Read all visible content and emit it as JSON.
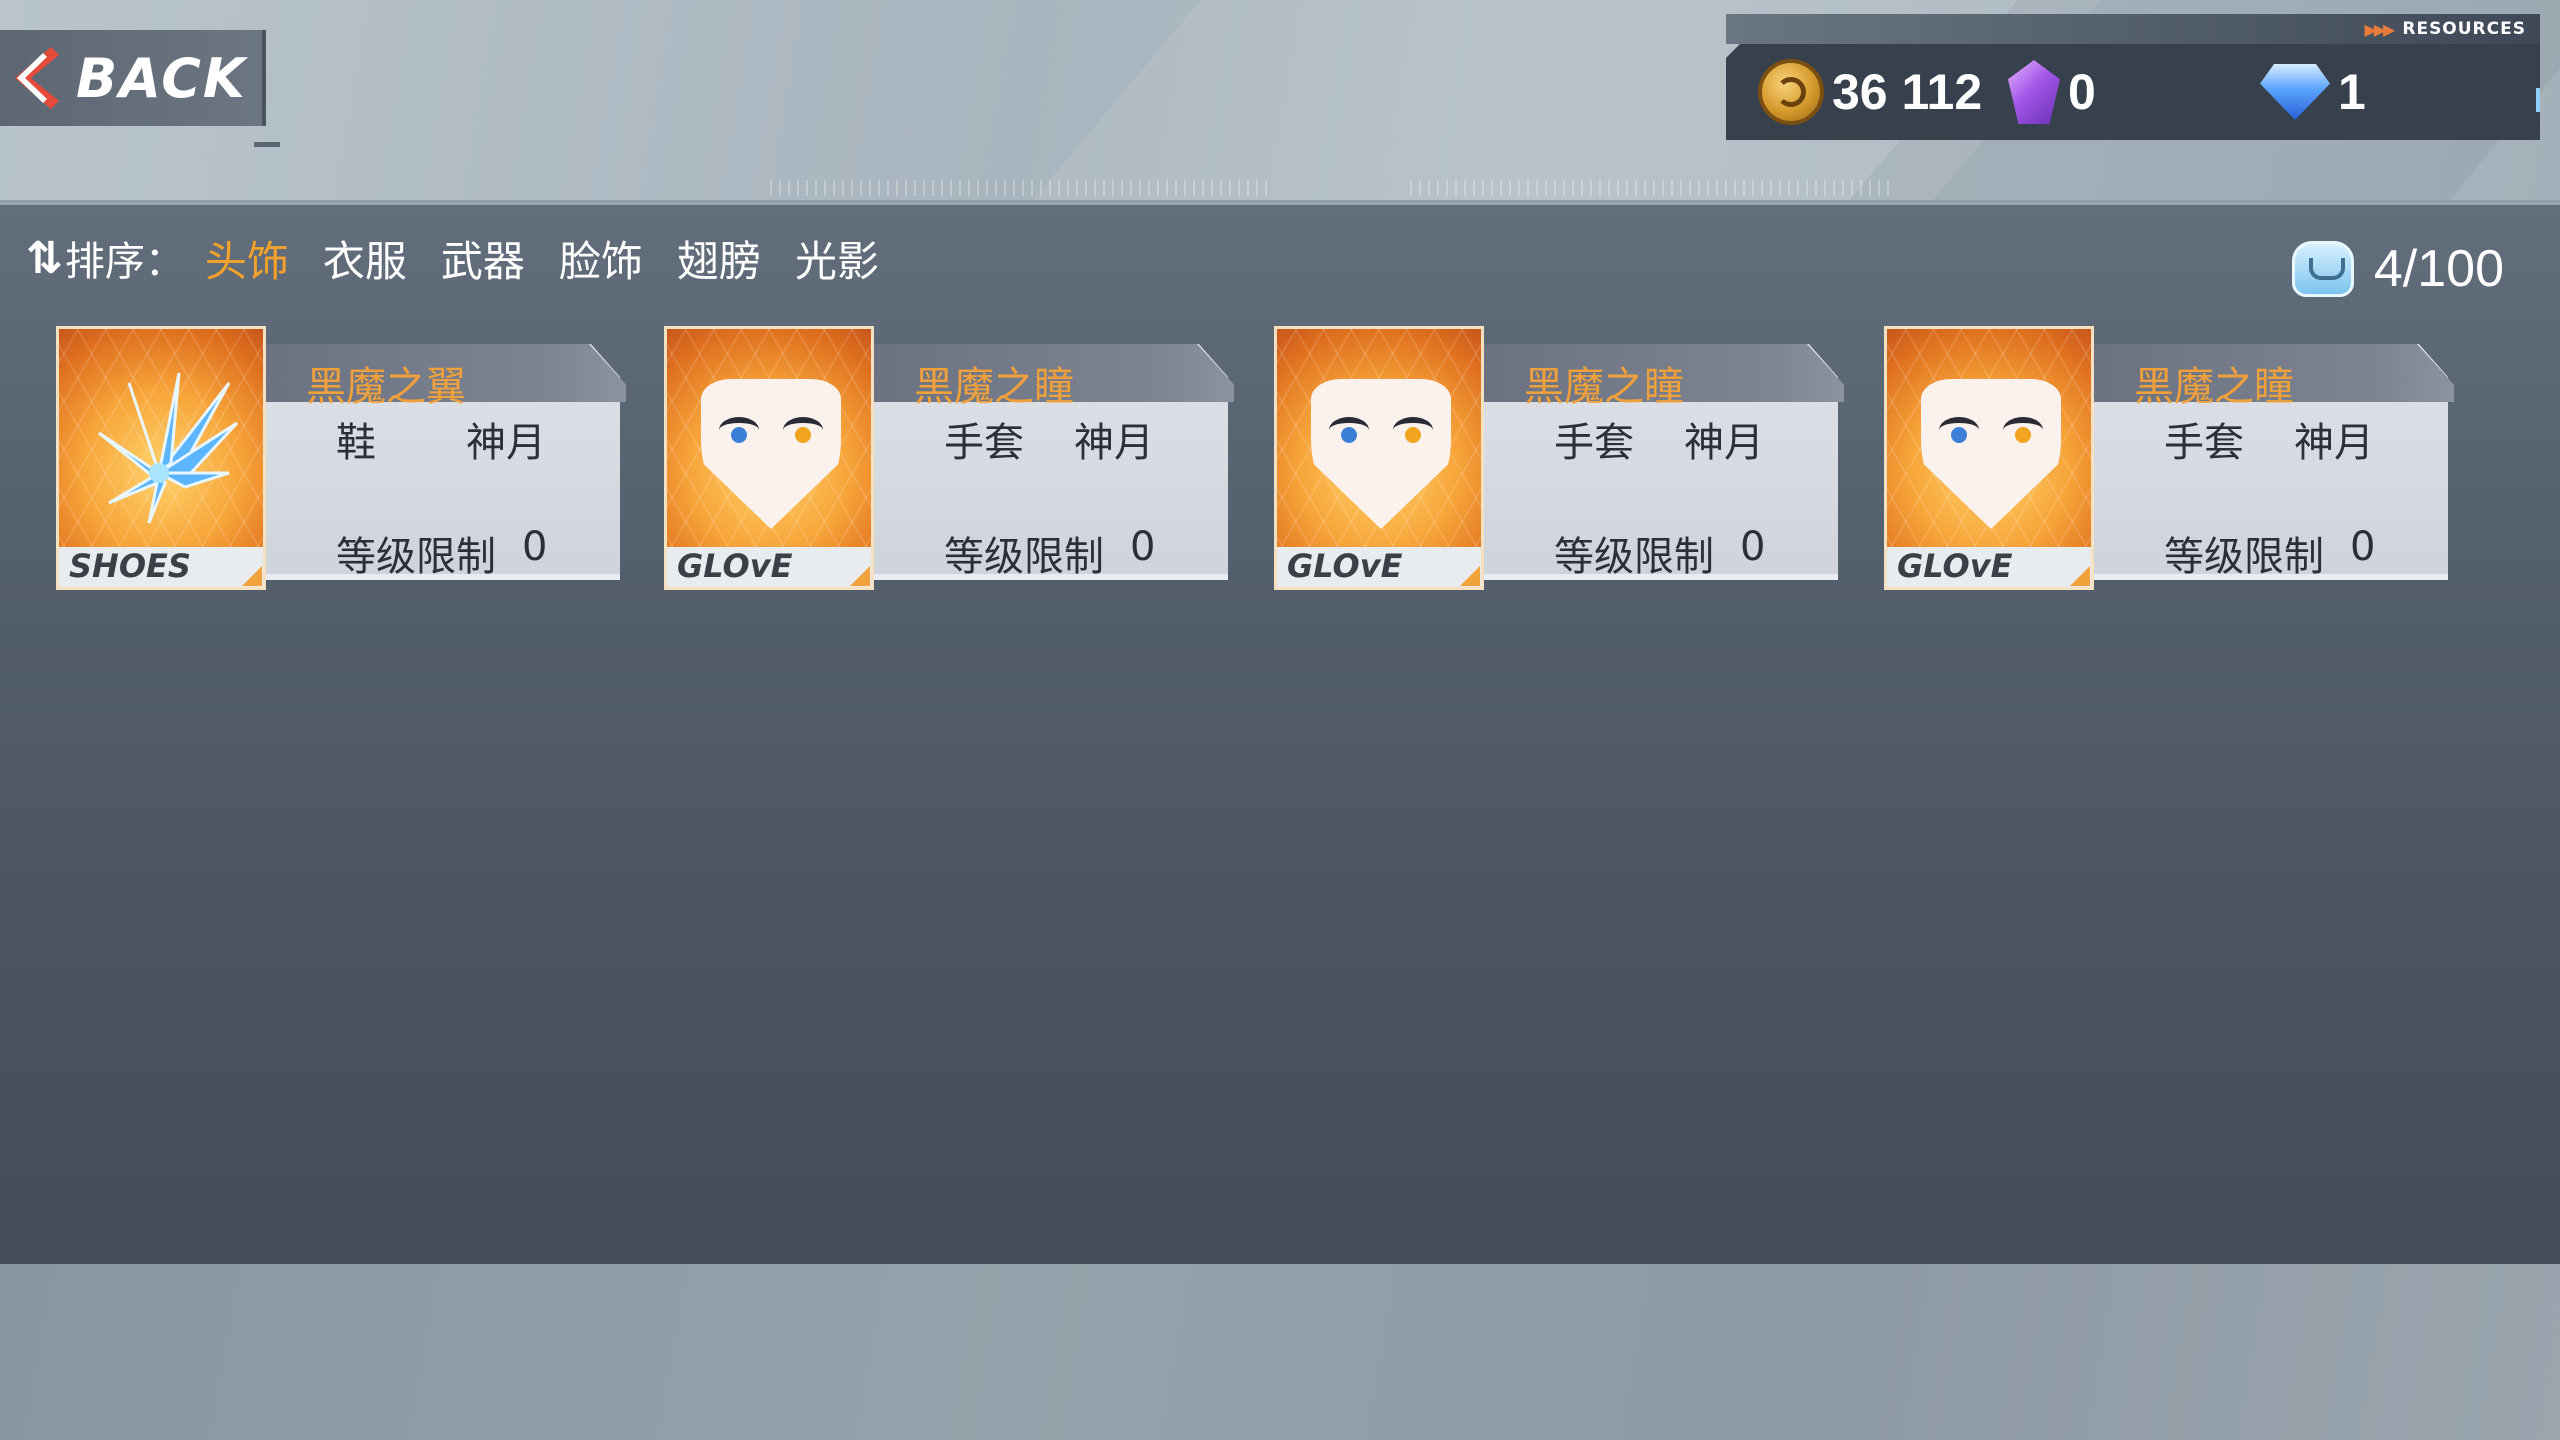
{
  "back": {
    "label": "BACK"
  },
  "resources": {
    "header": "RESOURCES",
    "items": [
      {
        "icon": "gold-coin-icon",
        "value": "36 112"
      },
      {
        "icon": "purple-crystal-icon",
        "value": "0"
      },
      {
        "icon": "blue-diamond-icon",
        "value": "1"
      }
    ]
  },
  "sort": {
    "label": "排序：",
    "tabs": [
      "头饰",
      "衣服",
      "武器",
      "脸饰",
      "翅膀",
      "光影"
    ],
    "active_index": 0
  },
  "capacity": {
    "value": "4/100"
  },
  "colors": {
    "accent": "#f2a22a",
    "panel": "#545f6d",
    "card": "#d8dbe1"
  },
  "items": [
    {
      "name": "黑魔之翼",
      "type": "鞋",
      "owner": "神月",
      "level_label": "等级限制",
      "level_value": "0",
      "tag": "SHOES",
      "icon": "blue-wing-icon"
    },
    {
      "name": "黑魔之瞳",
      "type": "手套",
      "owner": "神月",
      "level_label": "等级限制",
      "level_value": "0",
      "tag": "GLOvE",
      "icon": "eyes-face-icon"
    },
    {
      "name": "黑魔之瞳",
      "type": "手套",
      "owner": "神月",
      "level_label": "等级限制",
      "level_value": "0",
      "tag": "GLOvE",
      "icon": "eyes-face-icon"
    },
    {
      "name": "黑魔之瞳",
      "type": "手套",
      "owner": "神月",
      "level_label": "等级限制",
      "level_value": "0",
      "tag": "GLOvE",
      "icon": "eyes-face-icon"
    }
  ]
}
